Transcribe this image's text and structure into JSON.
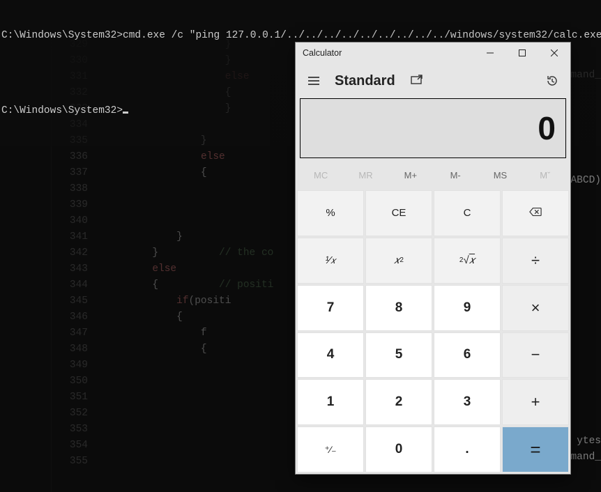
{
  "terminal": {
    "prompt1": "C:\\Windows\\System32>",
    "cmd1": "cmd.exe /c \"ping 127.0.0.1/../../../../../../../../../windows/system32/calc.exe\"",
    "prompt2": "C:\\Windows\\System32>"
  },
  "editor": {
    "first_line_no": 329,
    "line_count": 27,
    "lines": [
      "                     }",
      "                     }",
      "                     else",
      "                     {",
      "                     }",
      "",
      "                 }",
      "                 else",
      "                 {",
      "",
      "",
      "",
      "             }",
      "         }          // the co",
      "         else",
      "         {          // positi",
      "             if(positi",
      "             {",
      "                 f",
      "                 {",
      "",
      "",
      "",
      "",
      "",
      "",
      ""
    ],
    "right_snips": [
      "mand_",
      "ABCD)",
      "ytes",
      "mand_"
    ]
  },
  "calc": {
    "title": "Calculator",
    "mode": "Standard",
    "display": "0",
    "memory": [
      "MC",
      "MR",
      "M+",
      "M-",
      "MS",
      "Mˇ"
    ],
    "memory_disabled": [
      true,
      true,
      false,
      false,
      false,
      true
    ],
    "keys": {
      "percent": "%",
      "ce": "CE",
      "c": "C",
      "back": "⌫",
      "recip": "¹⁄ₓ",
      "square": "x²",
      "sqrt": "²√x",
      "div": "÷",
      "k7": "7",
      "k8": "8",
      "k9": "9",
      "mul": "×",
      "k4": "4",
      "k5": "5",
      "k6": "6",
      "sub": "−",
      "k1": "1",
      "k2": "2",
      "k3": "3",
      "add": "+",
      "neg": "⁺⁄₋",
      "k0": "0",
      "dot": ".",
      "eq": "="
    }
  }
}
